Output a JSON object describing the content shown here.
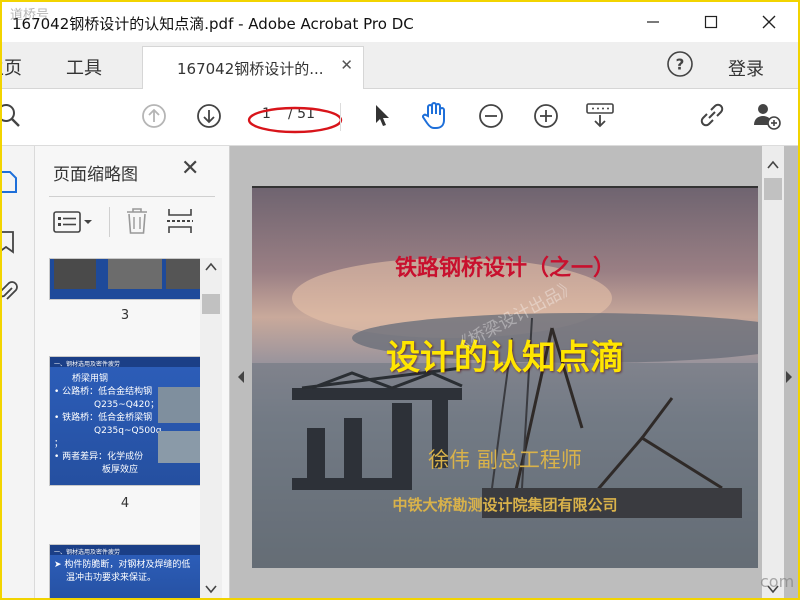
{
  "window": {
    "title": "167042钢桥设计的认知点滴.pdf - Adobe Acrobat Pro DC"
  },
  "tabs": {
    "home_label": "主页",
    "tools_label": "工具",
    "document_tab_label": "167042钢桥设计的...",
    "login_label": "登录"
  },
  "toolbar": {
    "current_page": "1",
    "total_pages": "/ 51"
  },
  "thumbnails_panel": {
    "title": "页面缩略图",
    "items": [
      {
        "label": "3"
      },
      {
        "label": "4",
        "header": "一、钢材选用及密件疲劳",
        "lines": [
          "桥梁用钢",
          "• 公路桥：低合金结构钢",
          "Q235~Q420；",
          "• 铁路桥：低合金桥梁钢",
          "Q235q~Q500q",
          "；",
          "• 两者差异：化学成份",
          "板厚效应"
        ]
      },
      {
        "header": "一、钢材选用及密件疲劳",
        "lines": [
          "➤ 构件防脆断，对钢材及焊缝的低",
          "温冲击功要求来保证。"
        ]
      }
    ]
  },
  "slide": {
    "title": "铁路钢桥设计（之一）",
    "main_title": "设计的认知点滴",
    "author": "徐伟   副总工程师",
    "organization": "中铁大桥勘测设计院集团有限公司",
    "watermark": "《桥梁设计出品》"
  },
  "watermarks": {
    "top_left": "道桥号",
    "bottom_right": "com"
  },
  "colors": {
    "frame_border": "#f2d400",
    "annotation_red": "#d8141a",
    "slide_title_red": "#c8102e",
    "slide_main_yellow": "#ffe600",
    "slide_author_gold": "#d9b24a",
    "thumb_blue": "#2c5db8"
  }
}
